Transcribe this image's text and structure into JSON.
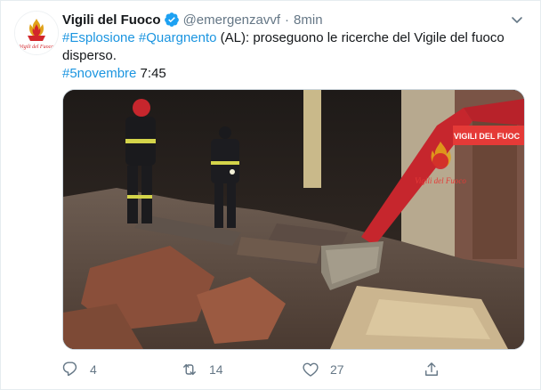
{
  "tweet": {
    "display_name": "Vigili del Fuoco",
    "handle": "@emergenzavvf",
    "separator": "·",
    "time": "8min",
    "text_parts": {
      "hashtag_1": "#Esplosione",
      "hashtag_2": "#Quargnento",
      "body": " (AL): proseguono le ricerche del Vigile del fuoco disperso.",
      "hashtag_3": "#5novembre",
      "clock": " 7:45"
    },
    "media": {
      "logo_text": "Vigili del Fuoco",
      "banner_text": "VIGILI DEL FUOC"
    },
    "avatar_text": "Vigili del Fuoco"
  },
  "actions": {
    "replies": "4",
    "retweets": "14",
    "likes": "27"
  },
  "colors": {
    "accent": "#1b95e0",
    "muted": "#657786",
    "verified": "#1da1f2",
    "brand_red": "#d2262b"
  },
  "icons": {
    "verified": "verified-badge-icon",
    "caret": "chevron-down-icon",
    "reply": "reply-icon",
    "retweet": "retweet-icon",
    "like": "heart-icon",
    "share": "share-icon"
  }
}
